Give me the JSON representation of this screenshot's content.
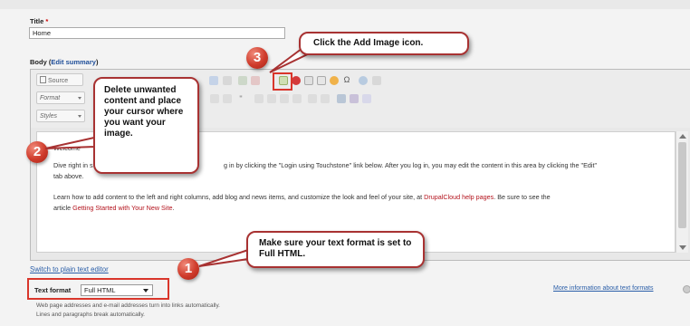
{
  "title_field": {
    "label": "Title",
    "required_mark": "*",
    "value": "Home"
  },
  "body_field": {
    "label": "Body",
    "edit_summary_link": "Edit summary"
  },
  "toolbar": {
    "source_label": "Source",
    "format_label": "Format",
    "styles_label": "Styles"
  },
  "content": {
    "welcome_fragment": "Welcome",
    "p1_start": "Dive right in s",
    "p1_end": "g in by clicking the \"Login using Touchstone\" link below. After you log in, you may edit the content in this area by clicking the \"Edit\"",
    "p1_line2": "tab above.",
    "p2_text": "Learn how to add content to the left and right columns, add blog and news items, and customize the look and feel of your site, at ",
    "p2_link": "DrupalCloud help pages",
    "p2_after": ". Be sure to see the",
    "p3_start": "article ",
    "p3_link": "Getting Started with Your New Site",
    "p3_end": "."
  },
  "switch_editor_link": "Switch to plain text editor",
  "text_format": {
    "label": "Text format",
    "selected": "Full HTML"
  },
  "more_info_link": "More information about text formats",
  "tips": [
    "Web page addresses and e-mail addresses turn into links automatically.",
    "Lines and paragraphs break automatically."
  ],
  "callouts": {
    "step1": {
      "number": "1",
      "text": "Make sure your text format is set to Full HTML."
    },
    "step2": {
      "number": "2",
      "text": "Delete unwanted content and place your cursor where you want your image."
    },
    "step3": {
      "number": "3",
      "text": "Click the Add Image icon."
    }
  },
  "colors": {
    "callout_border": "#a83232",
    "badge": "#cf3b2b",
    "link": "#2a5ea8",
    "content_link": "#b3121c"
  }
}
